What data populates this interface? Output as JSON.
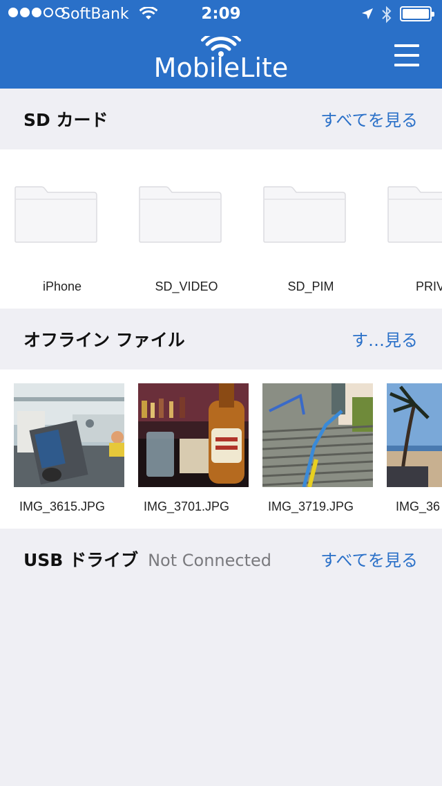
{
  "status_bar": {
    "carrier": "SoftBank",
    "time": "2:09",
    "icons": [
      "signal-dots",
      "wifi-icon",
      "location-arrow-icon",
      "bluetooth-icon",
      "battery-icon"
    ]
  },
  "header": {
    "logo_text": "MobileLite",
    "menu_icon": "hamburger-menu-icon",
    "bar_color": "#2a70c8"
  },
  "sd_card": {
    "title": "SD カード",
    "see_all": "すべてを見る",
    "folders": [
      {
        "label": "iPhone"
      },
      {
        "label": "SD_VIDEO"
      },
      {
        "label": "SD_PIM"
      },
      {
        "label": "PRIV"
      }
    ]
  },
  "offline": {
    "title": "オフライン ファイル",
    "see_all": "す…見る",
    "files": [
      {
        "label": "IMG_3615.JPG"
      },
      {
        "label": "IMG_3701.JPG"
      },
      {
        "label": "IMG_3719.JPG"
      },
      {
        "label": "IMG_36"
      }
    ]
  },
  "usb": {
    "title": "USB ドライブ",
    "status": "Not Connected",
    "see_all": "すべてを見る"
  }
}
